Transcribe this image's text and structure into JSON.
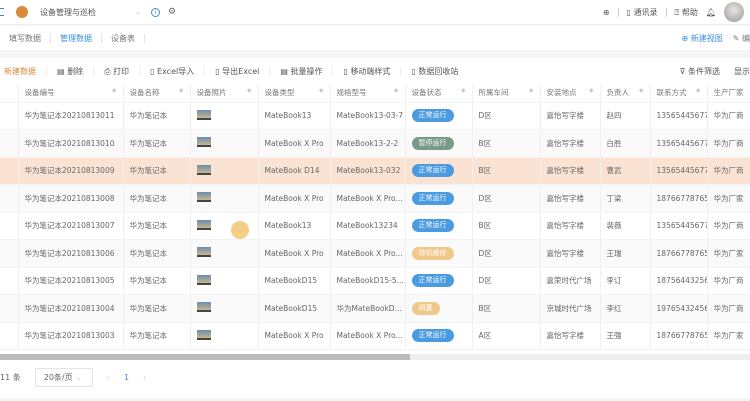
{
  "header": {
    "title": "设备管理与巡检",
    "actions": [
      "通讯录",
      "帮助"
    ]
  },
  "tabs": [
    {
      "label": "填写数据"
    },
    {
      "label": "管理数据"
    },
    {
      "label": "设备表"
    }
  ],
  "tab_actions": {
    "new_view": "新建视图",
    "edit": "编"
  },
  "toolbar": {
    "new": "新建数据",
    "delete": "删除",
    "print": "打印",
    "import": "Excel导入",
    "export": "导出Excel",
    "batch": "批量操作",
    "mobile": "移动端样式",
    "recycle": "数据回收站",
    "filter": "条件筛选",
    "display": "显示"
  },
  "columns": [
    "设备编号",
    "设备名称",
    "设备照片",
    "设备类型",
    "规格型号",
    "设备状态",
    "所属车间",
    "安装地点",
    "负责人",
    "联系方式",
    "生产厂家"
  ],
  "rows": [
    {
      "id": "华为笔记本20210813011",
      "name": "华为笔记本",
      "type": "MateBook13",
      "spec": "MateBook13-03-7",
      "status": "正常运行",
      "status_color": "#4a9be0",
      "ws": "D区",
      "loc": "嘉怡写字楼",
      "owner": "赵四",
      "phone": "13565445677",
      "maker": "华为厂商"
    },
    {
      "id": "华为笔记本20210813010",
      "name": "华为笔记本",
      "type": "MateBook X Pro",
      "spec": "MateBook13-2-2",
      "status": "暂停运行",
      "status_color": "#7a9a88",
      "ws": "B区",
      "loc": "嘉怡写字楼",
      "owner": "白胜",
      "phone": "13565445677",
      "maker": "华为厂商"
    },
    {
      "id": "华为笔记本20210813009",
      "name": "华为笔记本",
      "type": "MateBook D14",
      "spec": "MateBook13-032",
      "status": "正常运行",
      "status_color": "#4a9be0",
      "ws": "B区",
      "loc": "嘉怡写字楼",
      "owner": "曹武",
      "phone": "13565445677",
      "maker": "华为厂商"
    },
    {
      "id": "华为笔记本20210813008",
      "name": "华为笔记本",
      "type": "MateBook X Pro",
      "spec": "MateBook X Pro...",
      "status": "正常运行",
      "status_color": "#4a9be0",
      "ws": "D区",
      "loc": "嘉怡写字楼",
      "owner": "丁梁",
      "phone": "18766778765",
      "maker": "华为厂家"
    },
    {
      "id": "华为笔记本20210813007",
      "name": "华为笔记本",
      "type": "MateBook13",
      "spec": "MateBook13234",
      "status": "正常运行",
      "status_color": "#4a9be0",
      "ws": "B区",
      "loc": "嘉怡写字楼",
      "owner": "裴薇",
      "phone": "13565445677",
      "maker": "华为厂商"
    },
    {
      "id": "华为笔记本20210813006",
      "name": "华为笔记本",
      "type": "MateBook X Pro",
      "spec": "MateBook X Pro...",
      "status": "待机维修",
      "status_color": "#f0c88a",
      "ws": "D区",
      "loc": "嘉怡写字楼",
      "owner": "王瑞",
      "phone": "18766778765",
      "maker": "华为厂家"
    },
    {
      "id": "华为笔记本20210813005",
      "name": "华为笔记本",
      "type": "MateBookD15",
      "spec": "MateBookD15-5...",
      "status": "正常运行",
      "status_color": "#4a9be0",
      "ws": "D区",
      "loc": "嘉荣时代广场",
      "owner": "李订",
      "phone": "18756443256",
      "maker": "华为厂商"
    },
    {
      "id": "华为笔记本20210813004",
      "name": "华为笔记本",
      "type": "MateBookD15",
      "spec": "华为MateBookD...",
      "status": "闲置",
      "status_color": "#f0c88a",
      "ws": "B区",
      "loc": "京城时代广场",
      "owner": "李红",
      "phone": "19765432456",
      "maker": "华为厂商"
    },
    {
      "id": "华为笔记本20210813003",
      "name": "华为笔记本",
      "type": "MateBook X Pro",
      "spec": "MateBook X Pro...",
      "status": "正常运行",
      "status_color": "#4a9be0",
      "ws": "A区",
      "loc": "嘉怡写字楼",
      "owner": "王强",
      "phone": "18766778765",
      "maker": "华为厂家"
    }
  ],
  "pagination": {
    "total": "11 条",
    "page_size": "20条/页",
    "page": "1"
  }
}
